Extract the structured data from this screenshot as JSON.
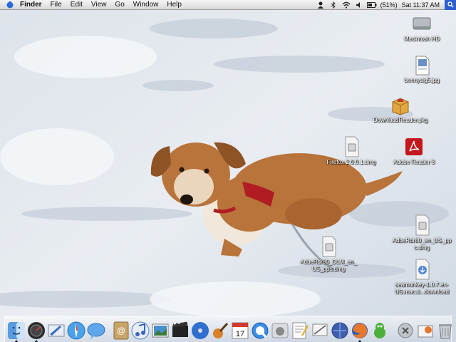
{
  "menubar": {
    "app_name": "Finder",
    "menus": [
      "File",
      "Edit",
      "View",
      "Go",
      "Window",
      "Help"
    ],
    "battery_text": "(51%)",
    "clock": "Sat 11:37 AM",
    "status_icons": [
      "user-icon",
      "bluetooth-icon",
      "wifi-icon",
      "volume-icon",
      "battery-icon",
      "spotlight-icon"
    ]
  },
  "desktop": {
    "icons": [
      {
        "label": "Macintosh HD",
        "icon": "hard-drive-icon"
      },
      {
        "label": "bennysig5.jpg",
        "icon": "jpeg-file-icon"
      },
      {
        "label": "DownloadReader.pkg",
        "icon": "package-icon"
      },
      {
        "label": "Firefox 2.0.0.1.dmg",
        "icon": "disk-image-icon"
      },
      {
        "label": "Adobe Reader 8",
        "icon": "adobe-reader-icon"
      },
      {
        "label": "AdbeRdr80_en_US_pp\nc.dmg",
        "icon": "disk-image-icon"
      },
      {
        "label": "AdbeRdr80_DLM_en_\nUS_ppc.dmg",
        "icon": "disk-image-icon"
      },
      {
        "label": "seamonkey-1.0.7.en-\nUS.mac.d...download",
        "icon": "download-file-icon"
      }
    ]
  },
  "dock": {
    "items": [
      {
        "name": "finder-icon",
        "running": true
      },
      {
        "name": "dashboard-icon",
        "running": true
      },
      {
        "name": "mail-icon",
        "running": false
      },
      {
        "name": "safari-icon",
        "running": false
      },
      {
        "name": "ichat-icon",
        "running": false
      },
      {
        "name": "address-book-icon",
        "running": false
      },
      {
        "name": "itunes-icon",
        "running": false
      },
      {
        "name": "iphoto-icon",
        "running": false
      },
      {
        "name": "imovie-icon",
        "running": false
      },
      {
        "name": "idvd-icon",
        "running": false
      },
      {
        "name": "garageband-icon",
        "running": false
      },
      {
        "name": "ical-icon",
        "running": false,
        "text": "17"
      },
      {
        "name": "quicktime-icon",
        "running": false
      },
      {
        "name": "apple-icon",
        "running": false
      },
      {
        "name": "textedit-icon",
        "running": false
      },
      {
        "name": "preview-icon",
        "running": false
      },
      {
        "name": "network-utility-icon",
        "running": false
      },
      {
        "name": "firefox-icon",
        "running": true
      },
      {
        "name": "adium-icon",
        "running": false
      },
      {
        "name": "applications-folder-icon",
        "running": false
      },
      {
        "name": "downloads-stack-icon",
        "running": false
      },
      {
        "name": "trash-icon",
        "running": false
      }
    ]
  },
  "colors": {
    "menubar_bg": "#e8e8e8",
    "snow": "#e6ebf0",
    "dog_fur": "#b8743a",
    "harness": "#b01c22",
    "dock_bg": "#c9d2dd"
  }
}
